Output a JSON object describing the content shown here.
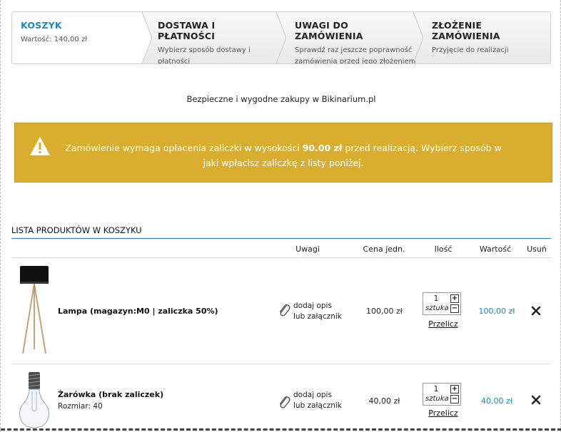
{
  "steps": [
    {
      "title": "KOSZYK",
      "sub": "Wartość: 140,00 zł"
    },
    {
      "title": "DOSTAWA I PŁATNOŚCI",
      "sub": "Wybierz sposób dostawy i płatności"
    },
    {
      "title": "UWAGI DO ZAMÓWIENIA",
      "sub": "Sprawdź raz jeszcze poprawność zamówienia przed jego złożeniem"
    },
    {
      "title": "ZŁOŻENIE ZAMÓWIENIA",
      "sub": "Przyjęcie do realizacji"
    }
  ],
  "secure_text": "Bezpieczne i wygodne zakupy w Bikinarium.pl",
  "alert": {
    "before": "Zamówienie wymaga opłacenia zaliczki w wysokości ",
    "amount": "90.00 zł",
    "after": " przed realizacją. Wybierz sposób w jaki wpłacisz zaliczkę z listy poniżej."
  },
  "list_title": "LISTA PRODUKTÓW W KOSZYKU",
  "columns": {
    "notes": "Uwagi",
    "unit_price": "Cena jedn.",
    "quantity": "Ilość",
    "value": "Wartość",
    "remove": "Usuń"
  },
  "products": [
    {
      "name": "Lampa (magazyn:M0 | zaliczka 50%)",
      "attr": "",
      "notes_line1": "dodaj opis",
      "notes_line2": "lub załącznik",
      "price": "100,00 zł",
      "qty": "1",
      "unit": "sztuka",
      "recalc": "Przelicz",
      "value": "100,00 zł"
    },
    {
      "name": "Żarówka (brak zaliczek)",
      "attr": "Rozmiar: 40",
      "notes_line1": "dodaj opis",
      "notes_line2": "lub załącznik",
      "price": "40,00 zł",
      "qty": "1",
      "unit": "sztuka",
      "recalc": "Przelicz",
      "value": "40,00 zł"
    }
  ],
  "icons": {
    "warning": "warning-triangle-icon",
    "attach": "paperclip-icon",
    "remove": "close-x-icon",
    "plus": "+",
    "minus": "−"
  },
  "colors": {
    "accent": "#1a8ac3",
    "alert_bg": "#d9ae2e"
  }
}
